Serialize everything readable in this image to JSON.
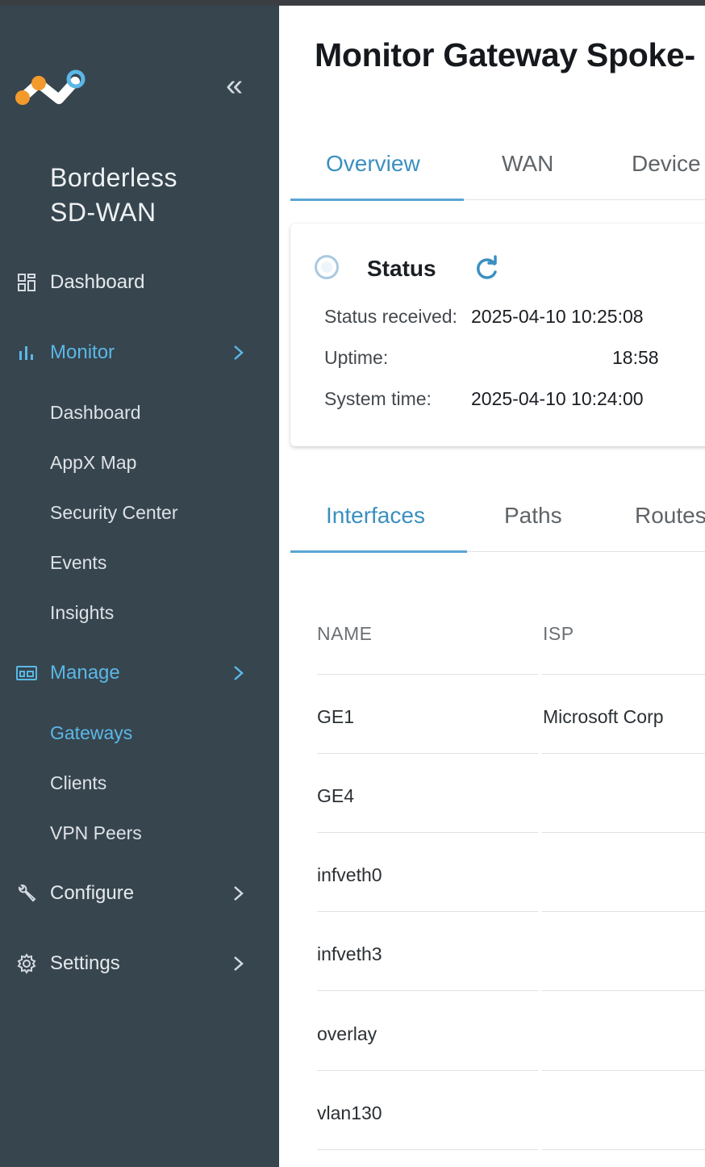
{
  "brand": {
    "line1": "Borderless",
    "line2": "SD-WAN"
  },
  "colors": {
    "sidebar_bg": "#37454f",
    "accent": "#5ab8e6",
    "logo_orange": "#f39a2c",
    "logo_blue": "#5ab8e6"
  },
  "sidebar": {
    "collapse_icon": "double-chevron-left-icon",
    "items": [
      {
        "label": "Dashboard",
        "icon": "grid-icon"
      },
      {
        "label": "Monitor",
        "icon": "bar-chart-icon",
        "sub": [
          "Dashboard",
          "AppX Map",
          "Security Center",
          "Events",
          "Insights"
        ]
      },
      {
        "label": "Manage",
        "icon": "device-icon",
        "sub": [
          "Gateways",
          "Clients",
          "VPN Peers"
        ]
      },
      {
        "label": "Configure",
        "icon": "wrench-icon"
      },
      {
        "label": "Settings",
        "icon": "gear-icon"
      }
    ]
  },
  "main": {
    "title": "Monitor Gateway Spoke-",
    "tabs": [
      "Overview",
      "WAN",
      "Device"
    ],
    "status": {
      "title": "Status",
      "received_label": "Status received:",
      "received_value": "2025-04-10 10:25:08",
      "uptime_label": "Uptime:",
      "uptime_value": "18:58",
      "systime_label": "System time:",
      "systime_value": "2025-04-10 10:24:00"
    },
    "subtabs": [
      "Interfaces",
      "Paths",
      "Routes"
    ],
    "table": {
      "columns": [
        "NAME",
        "ISP"
      ],
      "rows": [
        {
          "name": "GE1",
          "isp": "Microsoft Corp"
        },
        {
          "name": "GE4",
          "isp": ""
        },
        {
          "name": "infveth0",
          "isp": ""
        },
        {
          "name": "infveth3",
          "isp": ""
        },
        {
          "name": "overlay",
          "isp": ""
        },
        {
          "name": "vlan130",
          "isp": ""
        }
      ]
    }
  }
}
